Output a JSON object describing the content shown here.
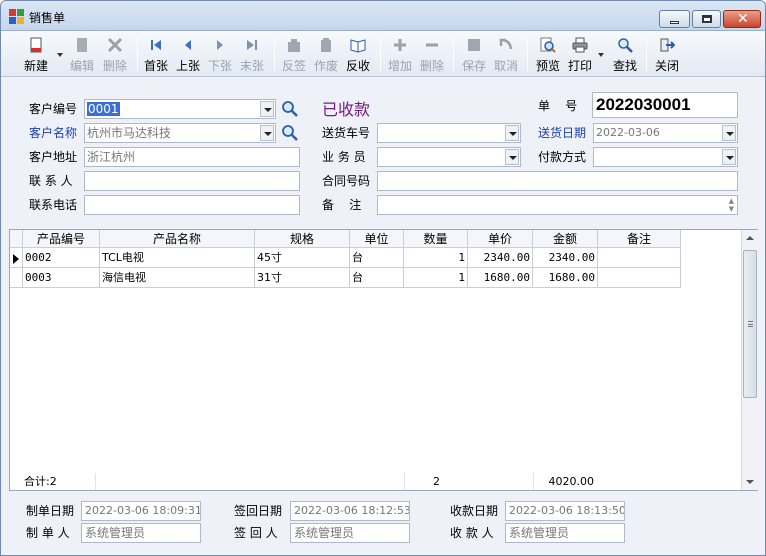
{
  "window": {
    "title": "销售单",
    "controls": {
      "minimize": "▭",
      "maximize": "□",
      "close": "✕"
    }
  },
  "toolbar": [
    {
      "id": "new",
      "label": "新建",
      "icon": "new-doc-icon",
      "enabled": true,
      "dropdown": true
    },
    {
      "id": "edit",
      "label": "编辑",
      "icon": "edit-icon",
      "enabled": false
    },
    {
      "id": "delete",
      "label": "删除",
      "icon": "delete-icon",
      "enabled": false
    },
    {
      "id": "first",
      "label": "首张",
      "icon": "first-icon",
      "enabled": true
    },
    {
      "id": "prev",
      "label": "上张",
      "icon": "prev-icon",
      "enabled": true
    },
    {
      "id": "next",
      "label": "下张",
      "icon": "next-icon",
      "enabled": false
    },
    {
      "id": "last",
      "label": "末张",
      "icon": "last-icon",
      "enabled": false
    },
    {
      "id": "unsign",
      "label": "反签",
      "icon": "unsign-icon",
      "enabled": false
    },
    {
      "id": "void",
      "label": "作废",
      "icon": "void-icon",
      "enabled": false
    },
    {
      "id": "unreceive",
      "label": "反收",
      "icon": "book-icon",
      "enabled": true
    },
    {
      "id": "add",
      "label": "增加",
      "icon": "plus-icon",
      "enabled": false
    },
    {
      "id": "remove",
      "label": "删除",
      "icon": "minus-icon",
      "enabled": false
    },
    {
      "id": "save",
      "label": "保存",
      "icon": "save-icon",
      "enabled": false
    },
    {
      "id": "cancel",
      "label": "取消",
      "icon": "undo-icon",
      "enabled": false
    },
    {
      "id": "preview",
      "label": "预览",
      "icon": "preview-icon",
      "enabled": true
    },
    {
      "id": "print",
      "label": "打印",
      "icon": "printer-icon",
      "enabled": true,
      "dropdown": true
    },
    {
      "id": "find",
      "label": "查找",
      "icon": "search-icon",
      "enabled": true
    },
    {
      "id": "close",
      "label": "关闭",
      "icon": "exit-icon",
      "enabled": true
    }
  ],
  "form": {
    "customer_code": {
      "label": "客户编号",
      "value": "0001"
    },
    "customer_name": {
      "label": "客户名称",
      "value": "杭州市马达科技"
    },
    "customer_address": {
      "label": "客户地址",
      "value": "浙江杭州"
    },
    "contact": {
      "label": "联 系 人",
      "value": ""
    },
    "phone": {
      "label": "联系电话",
      "value": ""
    },
    "status": "已收款",
    "vehicle": {
      "label": "送货车号",
      "value": ""
    },
    "salesman": {
      "label": "业 务 员",
      "value": ""
    },
    "contract": {
      "label": "合同号码",
      "value": ""
    },
    "remark": {
      "label": "备    注",
      "value": ""
    },
    "order_no": {
      "label": "单    号",
      "value": "2022030001"
    },
    "delivery_date": {
      "label": "送货日期",
      "value": "2022-03-06"
    },
    "payment": {
      "label": "付款方式",
      "value": ""
    }
  },
  "grid": {
    "columns": [
      "产品编号",
      "产品名称",
      "规格",
      "单位",
      "数量",
      "单价",
      "金额",
      "备注"
    ],
    "rows": [
      [
        "0002",
        "TCL电视",
        "45寸",
        "台",
        "1",
        "2340.00",
        "2340.00",
        ""
      ],
      [
        "0003",
        "海信电视",
        "31寸",
        "台",
        "1",
        "1680.00",
        "1680.00",
        ""
      ]
    ],
    "footer": {
      "total_label": "合计:2",
      "qty": "2",
      "amount": "4020.00"
    }
  },
  "bottom": {
    "created_date": {
      "label": "制单日期",
      "value": "2022-03-06 18:09:31"
    },
    "created_by": {
      "label": "制 单 人",
      "value": "系统管理员"
    },
    "signed_date": {
      "label": "签回日期",
      "value": "2022-03-06 18:12:53"
    },
    "signed_by": {
      "label": "签 回 人",
      "value": "系统管理员"
    },
    "received_date": {
      "label": "收款日期",
      "value": "2022-03-06 18:13:50"
    },
    "received_by": {
      "label": "收 款 人",
      "value": "系统管理员"
    }
  },
  "colors": {
    "accent_label": "#1a3fb0",
    "status": "#7a1a8a",
    "selection": "#3a6fd6"
  }
}
